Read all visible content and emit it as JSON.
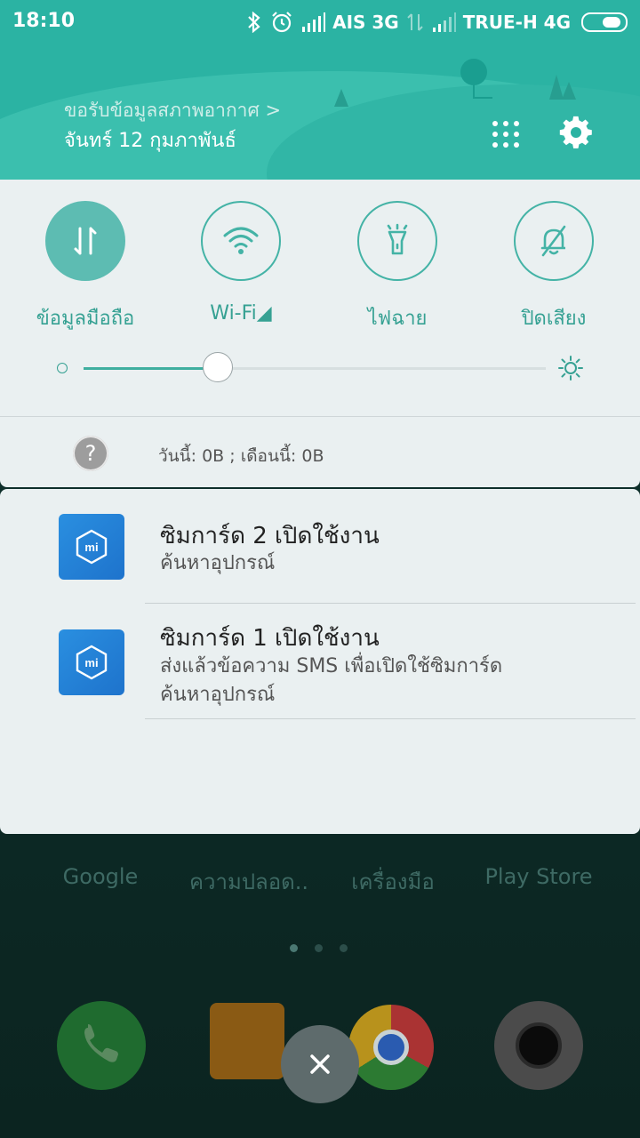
{
  "status_bar": {
    "time": "18:10",
    "carrier1": "AIS 3G",
    "carrier2": "TRUE-H 4G"
  },
  "header": {
    "weather_link": "ขอรับข้อมูลสภาพอากาศ >",
    "date": "จันทร์ 12 กุมภาพันธ์"
  },
  "quick_toggles": [
    {
      "label": "ข้อมูลมือถือ",
      "icon": "mobile-data-icon",
      "active": true
    },
    {
      "label": "Wi-Fi◢",
      "icon": "wifi-icon",
      "active": false
    },
    {
      "label": "ไฟฉาย",
      "icon": "flashlight-icon",
      "active": false
    },
    {
      "label": "ปิดเสียง",
      "icon": "bell-off-icon",
      "active": false
    }
  ],
  "brightness": {
    "level": 0.29
  },
  "data_usage": {
    "today": "วันนี้: 0B",
    "month": "; เดือนนี้: 0B"
  },
  "notifications": [
    {
      "title": "ซิมการ์ด 2 เปิดใช้งาน",
      "body": [
        "ค้นหาอุปกรณ์"
      ]
    },
    {
      "title": "ซิมการ์ด 1 เปิดใช้งาน",
      "body": [
        "ส่งแล้วข้อความ SMS เพื่อเปิดใช้ซิมการ์ด",
        "ค้นหาอุปกรณ์"
      ]
    }
  ],
  "home_apps": [
    "Google",
    "ความปลอด..",
    "เครื่องมือ",
    "Play Store"
  ],
  "colors": {
    "accent": "#2bb3a3",
    "toggle_on": "#5dbcb2",
    "notif_icon": "#1e73cc"
  }
}
